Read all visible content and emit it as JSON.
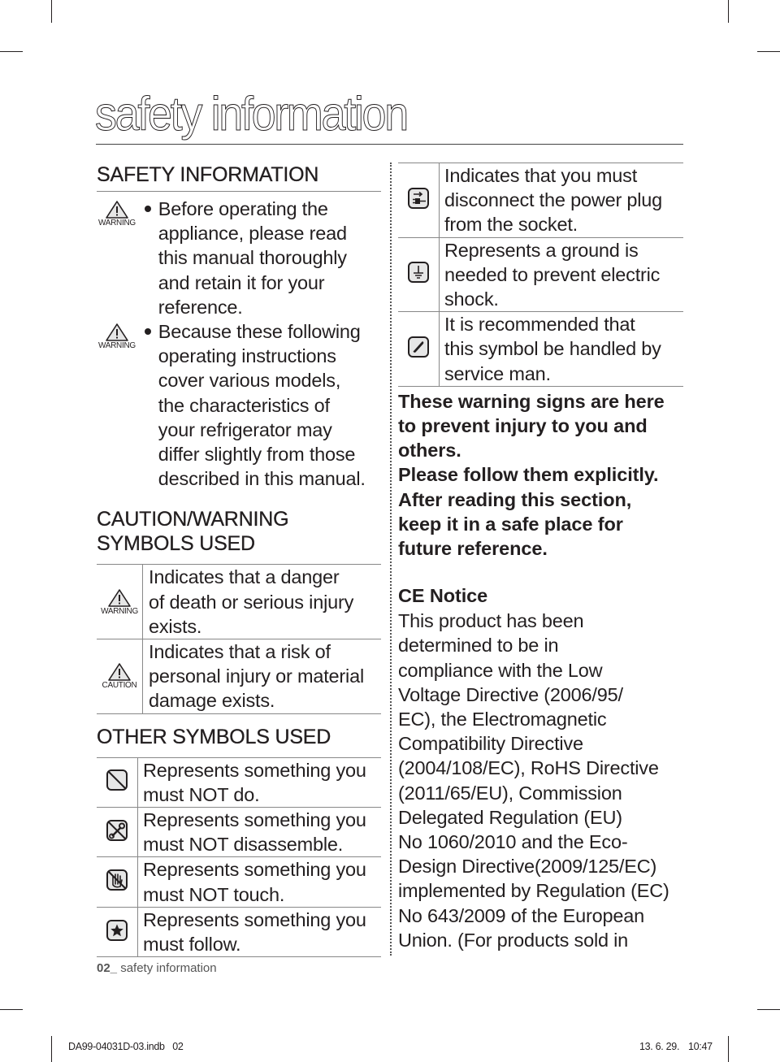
{
  "page": {
    "title": "safety information",
    "footer": {
      "page_number": "02_",
      "page_label": "safety information"
    },
    "slug": {
      "file": "DA99-04031D-03.indb   02",
      "date": "13. 6. 29.",
      "time": "10:47"
    }
  },
  "left": {
    "safety_heading": "SAFETY INFORMATION",
    "bullets": [
      {
        "icon": "warning-icon",
        "badge": "WARNING",
        "lines": [
          "Before operating the",
          "appliance, please read",
          "this manual thoroughly",
          "and retain it for your",
          "reference."
        ]
      },
      {
        "icon": "warning-icon",
        "badge": "WARNING",
        "lines": [
          "Because these following",
          "operating instructions",
          "cover various models,",
          "the characteristics of",
          "your refrigerator may",
          "differ slightly from those",
          "described in this manual."
        ]
      }
    ],
    "caution_heading_line1": "CAUTION/WARNING",
    "caution_heading_line2": "SYMBOLS USED",
    "caution_symbols": [
      {
        "icon": "warning-icon",
        "badge": "WARNING",
        "lines": [
          "Indicates that a danger",
          "of death or serious injury",
          "exists."
        ]
      },
      {
        "icon": "caution-icon",
        "badge": "CAUTION",
        "lines": [
          "Indicates that a risk of",
          "personal injury or material",
          "damage exists."
        ]
      }
    ],
    "other_heading": "OTHER SYMBOLS USED",
    "other_symbols": [
      {
        "icon": "prohibited-icon",
        "lines": [
          "Represents something you",
          "must NOT do."
        ]
      },
      {
        "icon": "no-disassemble-icon",
        "lines": [
          "Represents something you",
          "must NOT disassemble."
        ]
      },
      {
        "icon": "no-touch-icon",
        "lines": [
          "Represents something you",
          "must NOT touch."
        ]
      },
      {
        "icon": "must-follow-star-icon",
        "lines": [
          "Represents something you",
          "must follow."
        ]
      }
    ]
  },
  "right": {
    "symbols": [
      {
        "icon": "unplug-icon",
        "lines": [
          "Indicates that you must",
          "disconnect the power plug",
          "from the socket."
        ]
      },
      {
        "icon": "ground-icon",
        "lines": [
          "Represents a ground is",
          "needed to prevent electric",
          "shock."
        ]
      },
      {
        "icon": "service-phone-icon",
        "lines": [
          "It is recommended that",
          "this symbol be handled by",
          "service man."
        ]
      }
    ],
    "bold_lines": [
      "These warning signs are here",
      "to prevent injury to you and",
      "others.",
      "Please follow them explicitly.",
      "After reading this section,",
      "keep it in a safe place for",
      "future reference."
    ],
    "ce_title": "CE Notice",
    "ce_lines": [
      "This product has been",
      "determined to be in",
      "compliance with the Low",
      "Voltage Directive (2006/95/",
      "EC), the Electromagnetic",
      "Compatibility Directive",
      "(2004/108/EC), RoHS Directive",
      "(2011/65/EU), Commission",
      "Delegated Regulation (EU)",
      "No 1060/2010 and the Eco-",
      "Design Directive(2009/125/EC)",
      "implemented by Regulation (EC)",
      "No 643/2009 of the European",
      "Union. (For products sold in"
    ]
  }
}
